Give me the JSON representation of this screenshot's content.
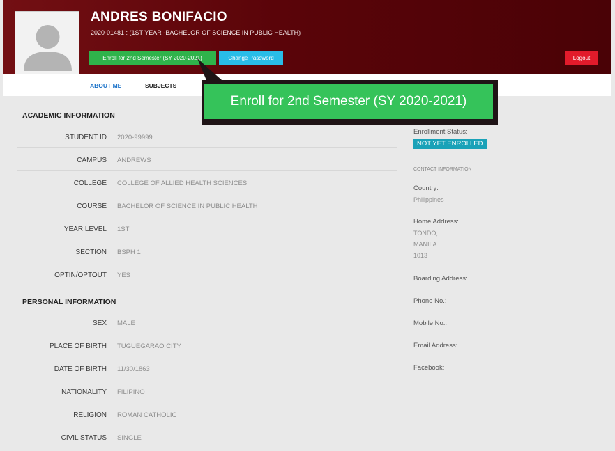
{
  "header": {
    "name": "ANDRES BONIFACIO",
    "subtitle": "2020-01481 : (1ST YEAR -BACHELOR OF SCIENCE IN PUBLIC HEALTH)",
    "enroll_label": "Enroll for 2nd Semester (SY 2020-2021)",
    "change_password_label": "Change Password",
    "logout_label": "Logout"
  },
  "tabs": [
    "ABOUT ME",
    "SUBJECTS"
  ],
  "callout": "Enroll for 2nd Semester (SY 2020-2021)",
  "academic": {
    "title": "ACADEMIC INFORMATION",
    "rows": [
      {
        "label": "STUDENT ID",
        "value": "2020-99999"
      },
      {
        "label": "CAMPUS",
        "value": "ANDREWS"
      },
      {
        "label": "COLLEGE",
        "value": "COLLEGE OF ALLIED HEALTH SCIENCES"
      },
      {
        "label": "COURSE",
        "value": "BACHELOR OF SCIENCE IN PUBLIC HEALTH"
      },
      {
        "label": "YEAR LEVEL",
        "value": "1ST"
      },
      {
        "label": "SECTION",
        "value": "BSPH 1"
      },
      {
        "label": "OPTIN/OPTOUT",
        "value": "YES"
      }
    ]
  },
  "personal": {
    "title": "PERSONAL INFORMATION",
    "rows": [
      {
        "label": "SEX",
        "value": "MALE"
      },
      {
        "label": "PLACE OF BIRTH",
        "value": "TUGUEGARAO CITY"
      },
      {
        "label": "DATE OF BIRTH",
        "value": "11/30/1863"
      },
      {
        "label": "NATIONALITY",
        "value": "FILIPINO"
      },
      {
        "label": "RELIGION",
        "value": "ROMAN CATHOLIC"
      },
      {
        "label": "CIVIL STATUS",
        "value": "SINGLE"
      }
    ]
  },
  "side": {
    "enrollment_label": "Enrollment Status:",
    "enrollment_badge": "NOT YET ENROLLED",
    "contact_heading": "CONTACT INFORMATION",
    "country_label": "Country:",
    "country_value": "Philippines",
    "home_label": "Home Address:",
    "home_lines": [
      "TONDO,",
      "MANILA",
      "1013"
    ],
    "boarding_label": "Boarding Address:",
    "phone_label": "Phone No.:",
    "mobile_label": "Mobile No.:",
    "email_label": "Email Address:",
    "facebook_label": "Facebook:"
  },
  "colors": {
    "header_bg": "#5a0409",
    "enroll_button": "#2fb34b",
    "change_password_button": "#29bde8",
    "logout_button": "#e21b2b",
    "status_badge": "#1aa2b8",
    "active_tab": "#1a72c9"
  }
}
